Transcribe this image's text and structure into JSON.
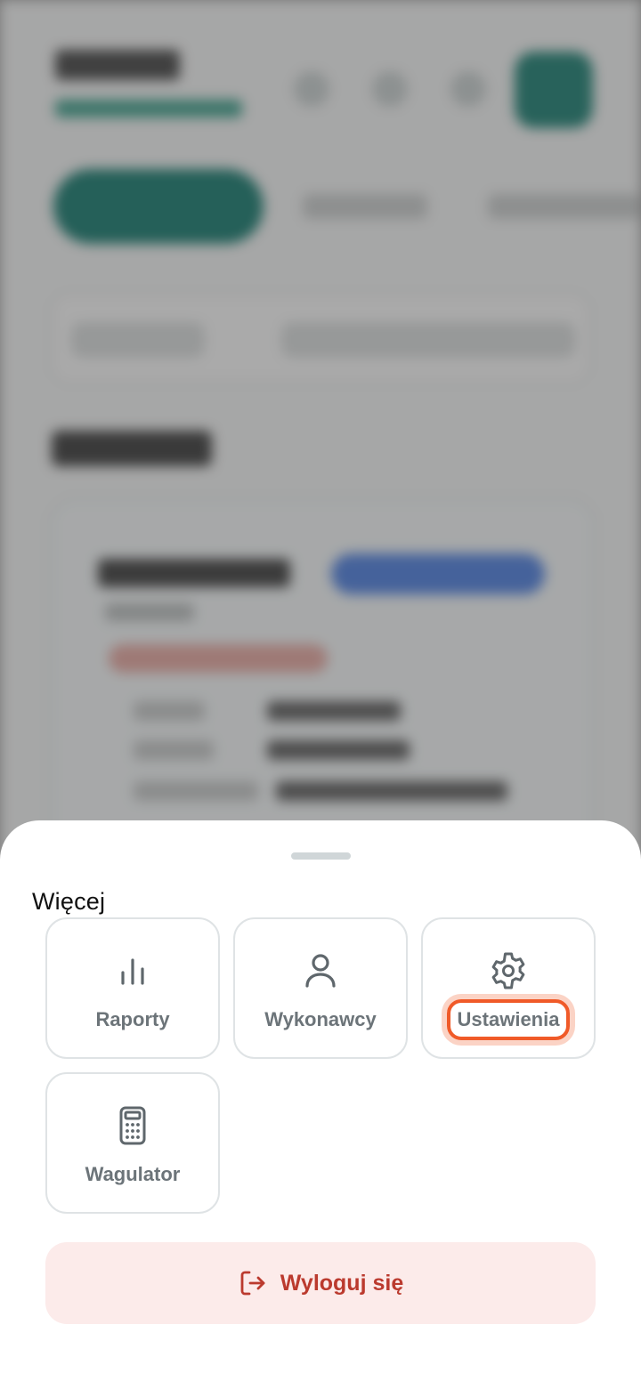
{
  "sheet": {
    "title": "Więcej",
    "tiles": [
      {
        "label": "Raporty",
        "icon": "bar-chart-icon"
      },
      {
        "label": "Wykonawcy",
        "icon": "user-icon"
      },
      {
        "label": "Ustawienia",
        "icon": "gear-icon",
        "highlighted": true
      },
      {
        "label": "Wagulator",
        "icon": "calculator-icon"
      }
    ],
    "logout": {
      "label": "Wyloguj się",
      "icon": "logout-icon"
    }
  },
  "colors": {
    "tile_label": "#6c7479",
    "highlight_ring": "#f05a28",
    "logout_bg": "#fcebea",
    "logout_text": "#bb3a2e",
    "accent_teal": "#157a6e"
  }
}
